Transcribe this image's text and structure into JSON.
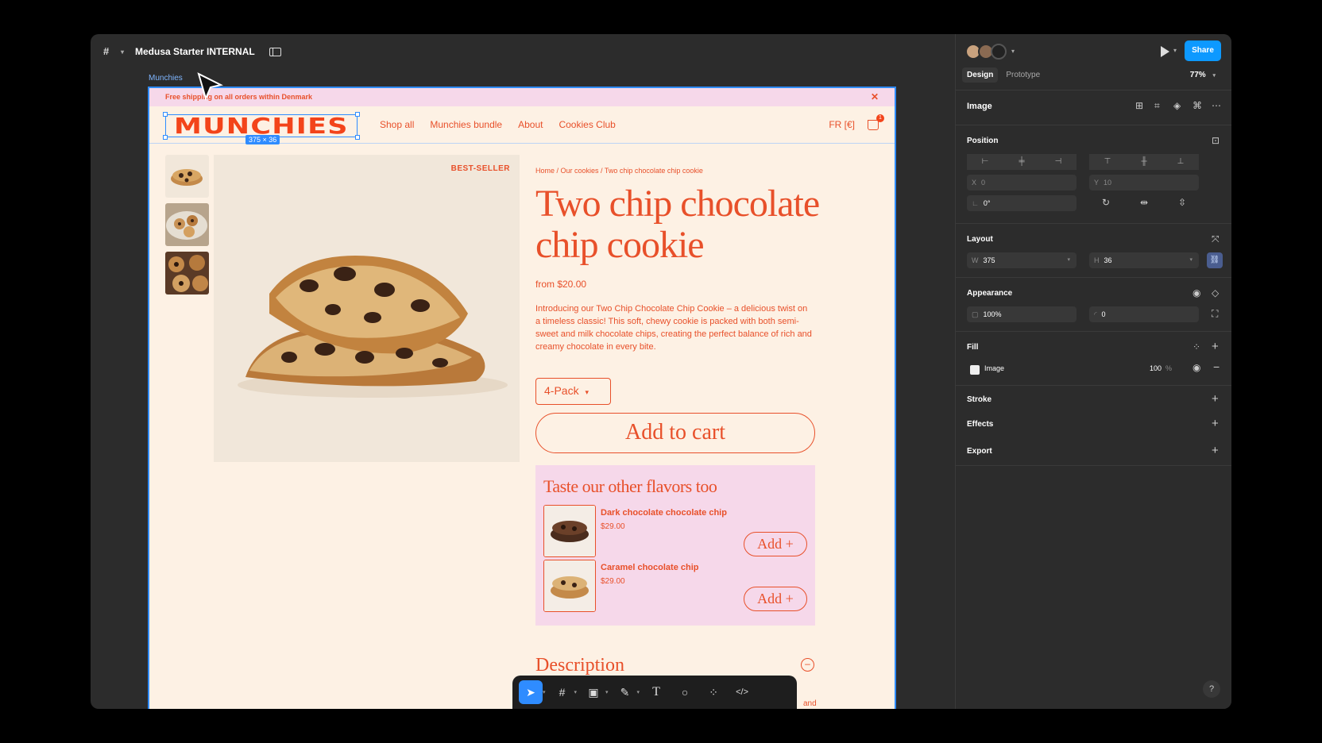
{
  "topbar": {
    "file_name": "Medusa Starter INTERNAL"
  },
  "canvas": {
    "frame_label": "Munchies",
    "selection_size": "375 × 36"
  },
  "site": {
    "announcement": "Free shipping on all orders within Denmark",
    "logo": "MUNCHIES",
    "nav": [
      "Shop all",
      "Munchies bundle",
      "About",
      "Cookies Club"
    ],
    "currency": "FR [€]",
    "cart_count": "1",
    "badge": "BEST-SELLER",
    "breadcrumb": "Home / Our cookies / Two chip chocolate chip cookie",
    "title": "Two chip chocolate chip cookie",
    "price": "from $20.00",
    "description": "Introducing our Two Chip Chocolate Chip Cookie – a delicious twist on a timeless classic! This soft, chewy cookie is packed with both semi-sweet and milk chocolate chips, creating the perfect balance of rich and creamy chocolate in every bite.",
    "pack_option": "4-Pack",
    "add_to_cart": "Add to cart",
    "flavors_title": "Taste our other flavors too",
    "flavors": [
      {
        "name": "Dark chocolate chocolate chip",
        "price": "$29.00",
        "add": "Add +"
      },
      {
        "name": "Caramel chocolate chip",
        "price": "$29.00",
        "add": "Add +"
      }
    ],
    "description_heading": "Description",
    "tail": "and"
  },
  "panel": {
    "tabs": [
      "Design",
      "Prototype"
    ],
    "zoom": "77%",
    "share": "Share",
    "layer_type": "Image",
    "position": {
      "title": "Position",
      "x_label": "X",
      "x": "0",
      "y_label": "Y",
      "y": "10",
      "rotation": "0°"
    },
    "layout": {
      "title": "Layout",
      "w_label": "W",
      "w": "375",
      "h_label": "H",
      "h": "36"
    },
    "appearance": {
      "title": "Appearance",
      "opacity": "100%",
      "radius": "0"
    },
    "fill": {
      "title": "Fill",
      "type": "Image",
      "opacity": "100",
      "unit": "%"
    },
    "stroke": "Stroke",
    "effects": "Effects",
    "export": "Export",
    "help": "?"
  },
  "colors": {
    "brand": "#e8502a",
    "accent": "#0d99ff",
    "selection": "#2f8cff"
  }
}
